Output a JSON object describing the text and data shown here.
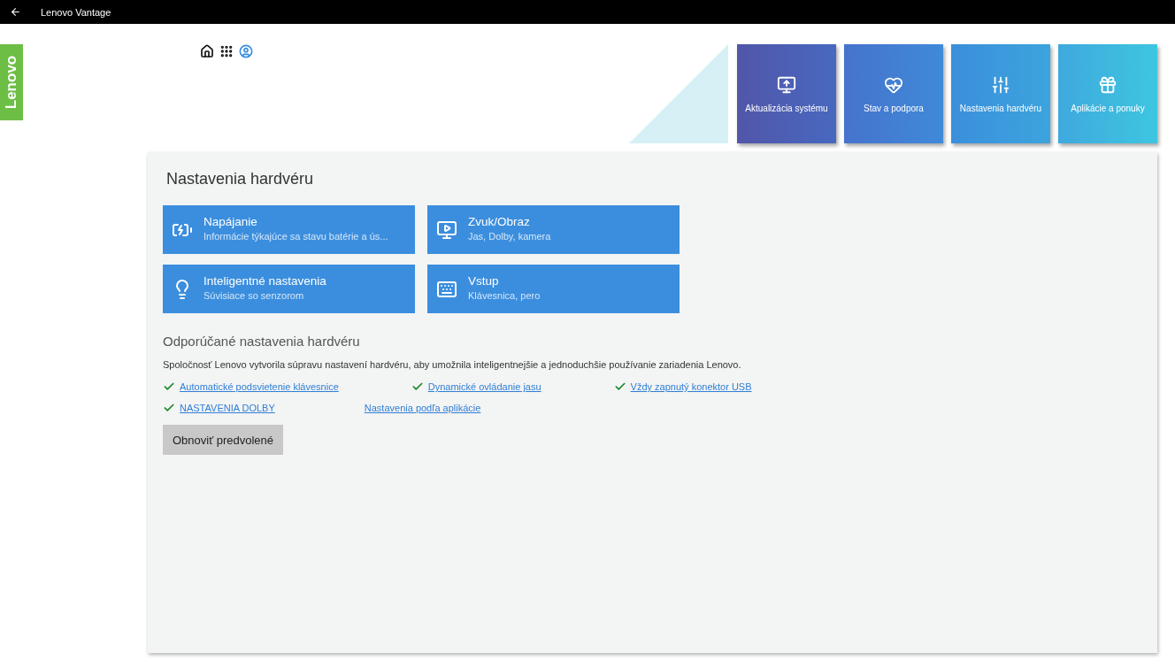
{
  "window": {
    "title": "Lenovo Vantage"
  },
  "logo": {
    "text": "Lenovo"
  },
  "nav_tiles": [
    {
      "label": "Aktualizácia systému"
    },
    {
      "label": "Stav a podpora"
    },
    {
      "label": "Nastavenia hardvéru"
    },
    {
      "label": "Aplikácie a ponuky"
    }
  ],
  "panel": {
    "title": "Nastavenia hardvéru",
    "cards": [
      {
        "title": "Napájanie",
        "subtitle": "Informácie týkajúce sa stavu batérie a ús..."
      },
      {
        "title": "Zvuk/Obraz",
        "subtitle": "Jas, Dolby, kamera"
      },
      {
        "title": "Inteligentné nastavenia",
        "subtitle": "Súvisiace so senzorom"
      },
      {
        "title": "Vstup",
        "subtitle": "Klávesnica, pero"
      }
    ],
    "recommended": {
      "heading": "Odporúčané nastavenia hardvéru",
      "description": "Spoločnosť Lenovo vytvorila súpravu nastavení hardvéru, aby umožnila inteligentnejšie a jednoduchšie používanie zariadenia Lenovo.",
      "links": [
        {
          "label": "Automatické podsvietenie klávesnice",
          "checked": true
        },
        {
          "label": "Dynamické ovládanie jasu",
          "checked": true
        },
        {
          "label": "Vždy zapnutý konektor USB",
          "checked": true
        },
        {
          "label": "NASTAVENIA DOLBY",
          "checked": true
        },
        {
          "label": "Nastavenia podľa aplikácie",
          "checked": false
        }
      ]
    },
    "reset_button": "Obnoviť predvolené"
  }
}
